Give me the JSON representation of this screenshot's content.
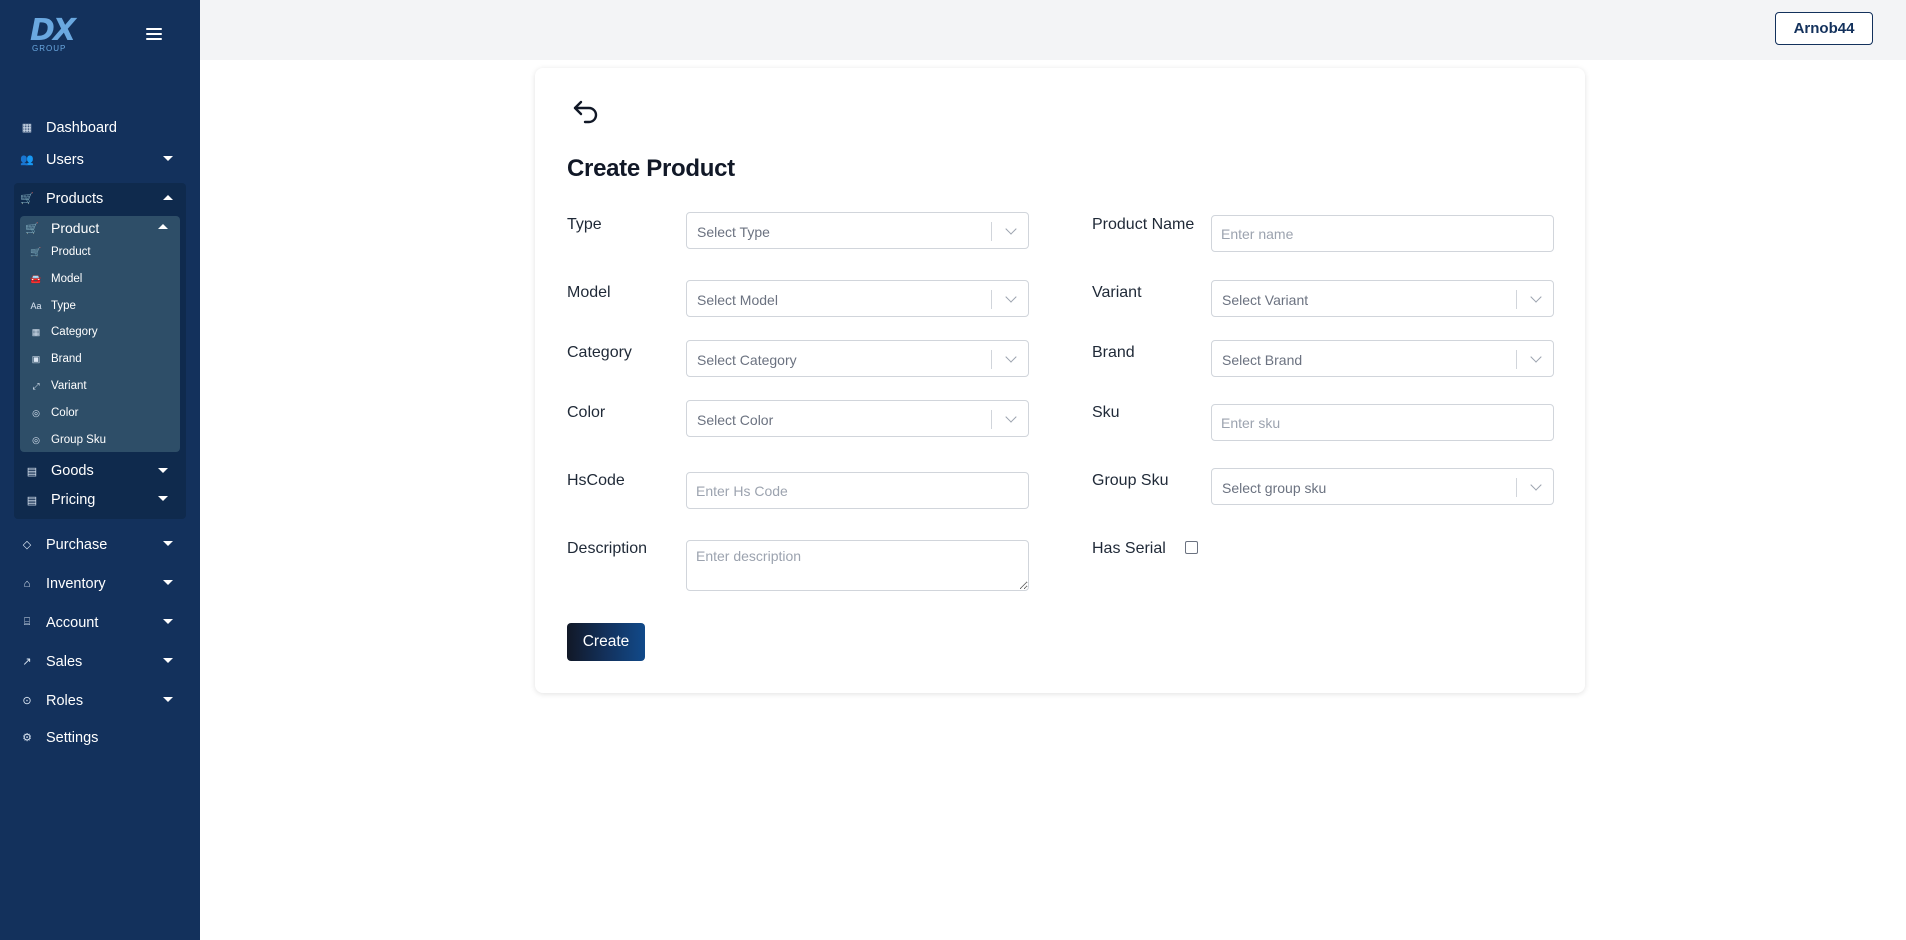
{
  "logo": {
    "text": "DX",
    "sub": "GROUP"
  },
  "header": {
    "user_button": "Arnob44"
  },
  "sidebar": {
    "items": [
      {
        "label": "Dashboard",
        "icon": "dashboard-icon"
      },
      {
        "label": "Users",
        "icon": "users-icon"
      },
      {
        "label": "Products",
        "icon": "cart-icon"
      },
      {
        "label": "Goods",
        "icon": "box-icon"
      },
      {
        "label": "Pricing",
        "icon": "pricing-icon"
      },
      {
        "label": "Purchase",
        "icon": "tag-icon"
      },
      {
        "label": "Inventory",
        "icon": "warehouse-icon"
      },
      {
        "label": "Account",
        "icon": "bank-icon"
      },
      {
        "label": "Sales",
        "icon": "chart-icon"
      },
      {
        "label": "Roles",
        "icon": "target-icon"
      },
      {
        "label": "Settings",
        "icon": "gear-icon"
      }
    ],
    "product_group": {
      "label": "Product",
      "children": [
        "Product",
        "Model",
        "Type",
        "Category",
        "Brand",
        "Variant",
        "Color",
        "Group Sku"
      ]
    }
  },
  "form": {
    "title": "Create Product",
    "type": {
      "label": "Type",
      "placeholder": "Select Type"
    },
    "product_name": {
      "label": "Product Name",
      "placeholder": "Enter name"
    },
    "model": {
      "label": "Model",
      "placeholder": "Select Model"
    },
    "variant": {
      "label": "Variant",
      "placeholder": "Select Variant"
    },
    "category": {
      "label": "Category",
      "placeholder": "Select Category"
    },
    "brand": {
      "label": "Brand",
      "placeholder": "Select Brand"
    },
    "color": {
      "label": "Color",
      "placeholder": "Select Color"
    },
    "sku": {
      "label": "Sku",
      "placeholder": "Enter sku"
    },
    "hscode": {
      "label": "HsCode",
      "placeholder": "Enter Hs Code"
    },
    "group_sku": {
      "label": "Group Sku",
      "placeholder": "Select group sku"
    },
    "description": {
      "label": "Description",
      "placeholder": "Enter description"
    },
    "has_serial": {
      "label": "Has Serial",
      "checked": false
    },
    "create_label": "Create"
  }
}
